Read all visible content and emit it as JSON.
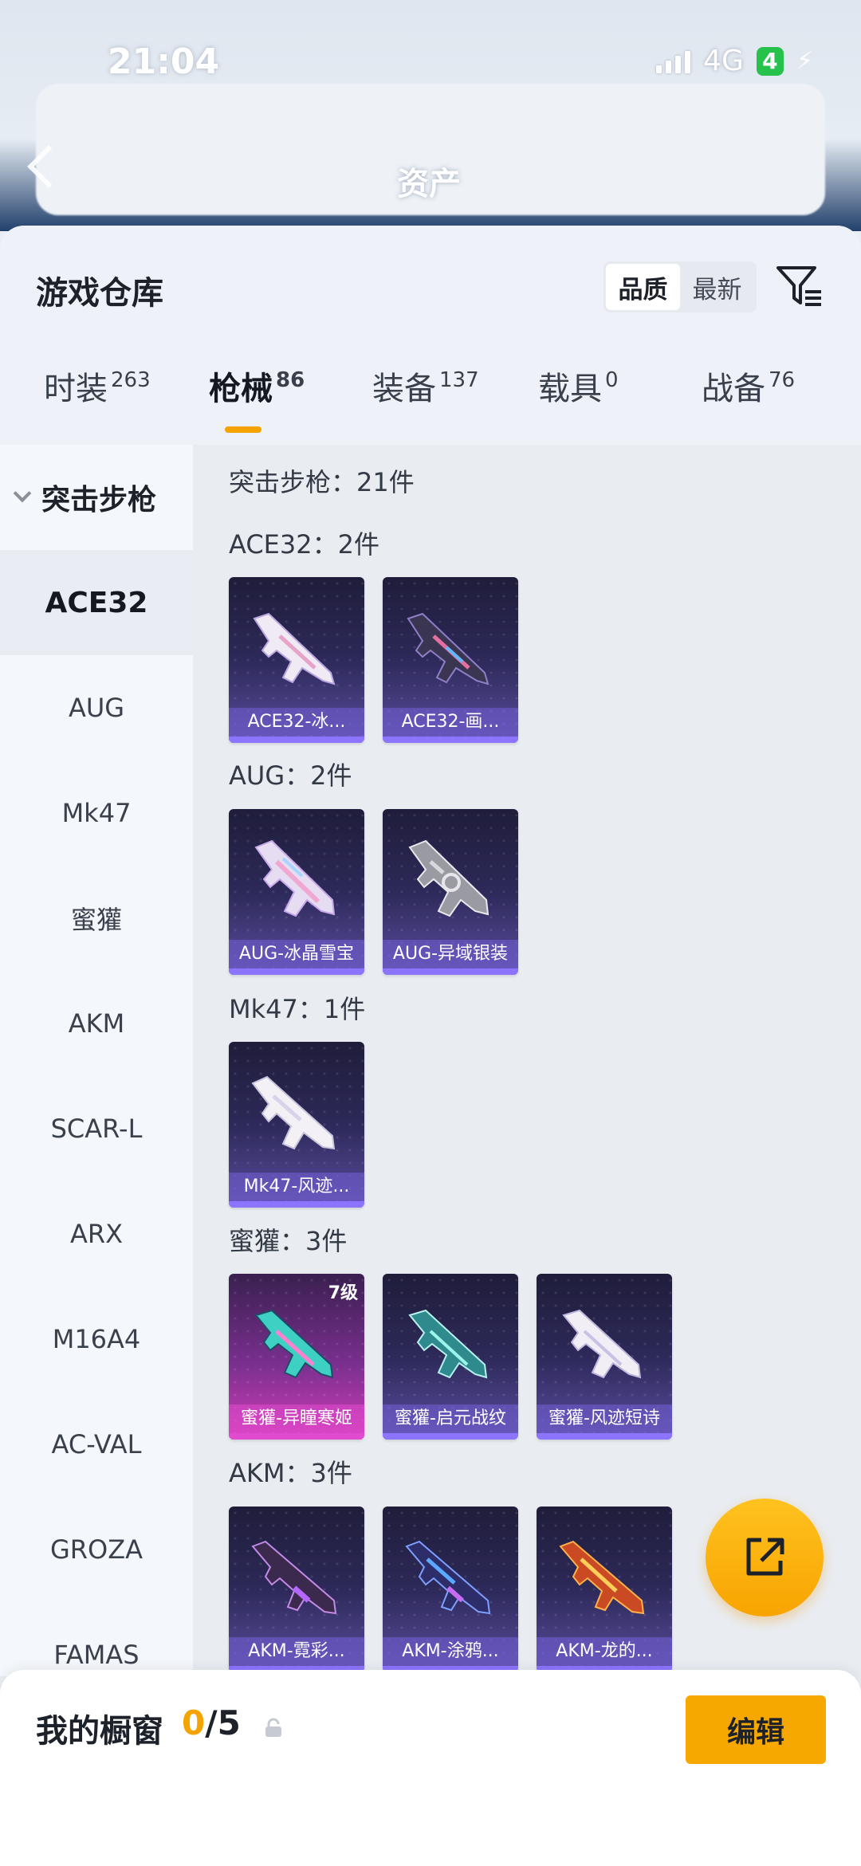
{
  "status_bar": {
    "time": "21:04",
    "network": "4G",
    "battery": "4"
  },
  "header": {
    "title": "资产"
  },
  "sheet": {
    "title": "游戏仓库",
    "sort_options": [
      "品质",
      "最新"
    ],
    "sort_active": "品质"
  },
  "tabs": [
    {
      "label": "时装",
      "count": "263"
    },
    {
      "label": "枪械",
      "count": "86"
    },
    {
      "label": "装备",
      "count": "137"
    },
    {
      "label": "载具",
      "count": "0"
    },
    {
      "label": "战备",
      "count": "76"
    }
  ],
  "active_tab": "枪械",
  "sidebar": {
    "section": "突击步枪",
    "items": [
      "ACE32",
      "AUG",
      "Mk47",
      "蜜獾",
      "AKM",
      "SCAR-L",
      "ARX",
      "M16A4",
      "AC-VAL",
      "GROZA",
      "FAMAS"
    ],
    "active": "ACE32"
  },
  "content": {
    "category_title": "突击步枪：21件",
    "groups": [
      {
        "title": "ACE32：2件",
        "items": [
          {
            "name": "ACE32-冰...",
            "tone": "blue"
          },
          {
            "name": "ACE32-画...",
            "tone": "blue"
          }
        ]
      },
      {
        "title": "AUG：2件",
        "items": [
          {
            "name": "AUG-冰晶雪宝",
            "tone": "blue"
          },
          {
            "name": "AUG-异域银装",
            "tone": "blue"
          }
        ]
      },
      {
        "title": "Mk47：1件",
        "items": [
          {
            "name": "Mk47-风迹...",
            "tone": "blue"
          }
        ]
      },
      {
        "title": "蜜獾：3件",
        "items": [
          {
            "name": "蜜獾-异瞳寒姬",
            "tone": "pink",
            "level": "7级"
          },
          {
            "name": "蜜獾-启元战纹",
            "tone": "blue"
          },
          {
            "name": "蜜獾-风迹短诗",
            "tone": "blue"
          }
        ]
      },
      {
        "title": "AKM：3件",
        "items": [
          {
            "name": "AKM-霓彩...",
            "tone": "blue"
          },
          {
            "name": "AKM-涂鸦...",
            "tone": "blue"
          },
          {
            "name": "AKM-龙的...",
            "tone": "blue"
          }
        ]
      }
    ]
  },
  "showcase": {
    "label": "我的橱窗",
    "used": "0",
    "total": "/5",
    "edit_label": "编辑"
  },
  "colors": {
    "accent": "#f6a800",
    "rare": "#e14bd0",
    "common": "#8d74ff"
  }
}
